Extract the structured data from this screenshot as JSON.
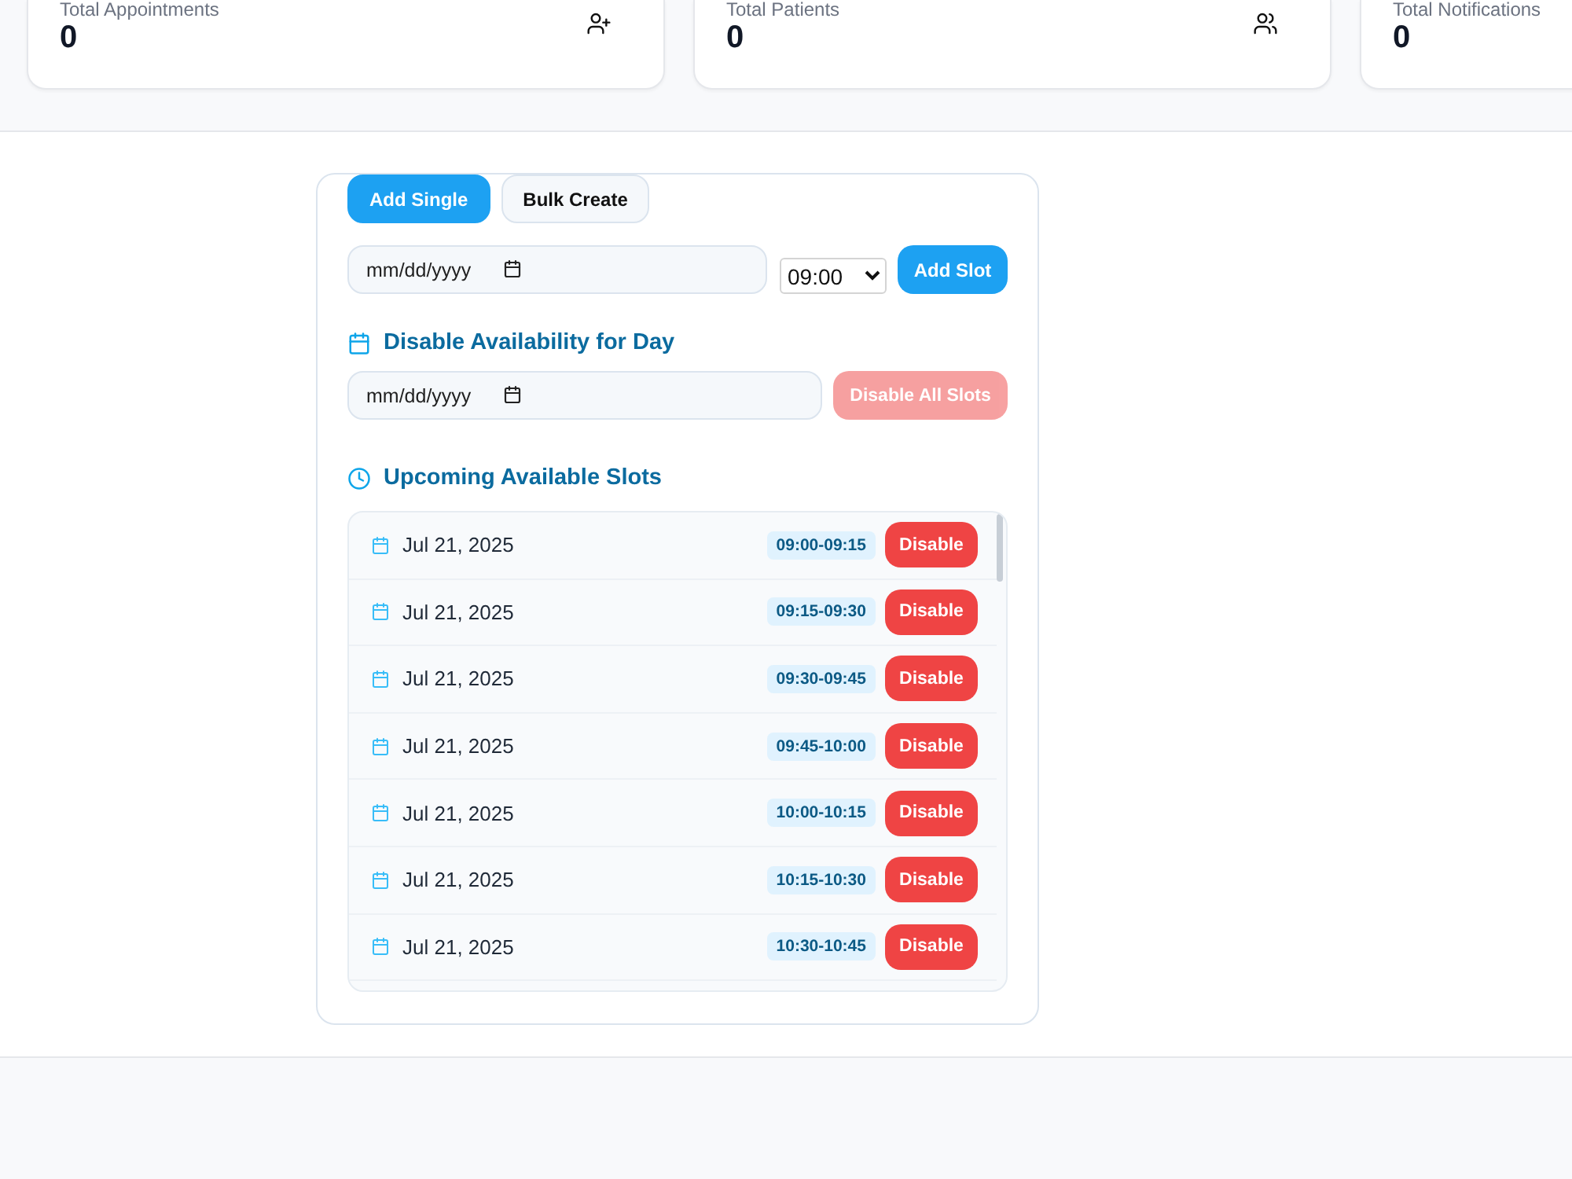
{
  "stats": [
    {
      "kind": "appointments",
      "label": "Total Appointments",
      "value": "0"
    },
    {
      "kind": "patients",
      "label": "Total Patients",
      "value": "0"
    },
    {
      "kind": "notifications",
      "label": "Total Notifications",
      "value": "0"
    }
  ],
  "tabs": [
    {
      "label": "Add Single",
      "selected": true
    },
    {
      "label": "Bulk Create",
      "selected": false
    }
  ],
  "add_slot": {
    "date_placeholder": "mm/dd/yyyy",
    "time": "09:00",
    "button": "Add Slot"
  },
  "disable_day": {
    "title": "Disable Availability for Day",
    "date_placeholder": "mm/dd/yyyy",
    "button": {
      "label": "Disable All Slots",
      "disabled": true
    }
  },
  "slots": {
    "title": "Upcoming Available Slots",
    "items": [
      {
        "date": "Jul 21, 2025",
        "time": "09:00-09:15",
        "action": "Disable"
      },
      {
        "date": "Jul 21, 2025",
        "time": "09:15-09:30",
        "action": "Disable"
      },
      {
        "date": "Jul 21, 2025",
        "time": "09:30-09:45",
        "action": "Disable"
      },
      {
        "date": "Jul 21, 2025",
        "time": "09:45-10:00",
        "action": "Disable"
      },
      {
        "date": "Jul 21, 2025",
        "time": "10:00-10:15",
        "action": "Disable"
      },
      {
        "date": "Jul 21, 2025",
        "time": "10:15-10:30",
        "action": "Disable"
      },
      {
        "date": "Jul 21, 2025",
        "time": "10:30-10:45",
        "action": "Disable"
      }
    ]
  }
}
